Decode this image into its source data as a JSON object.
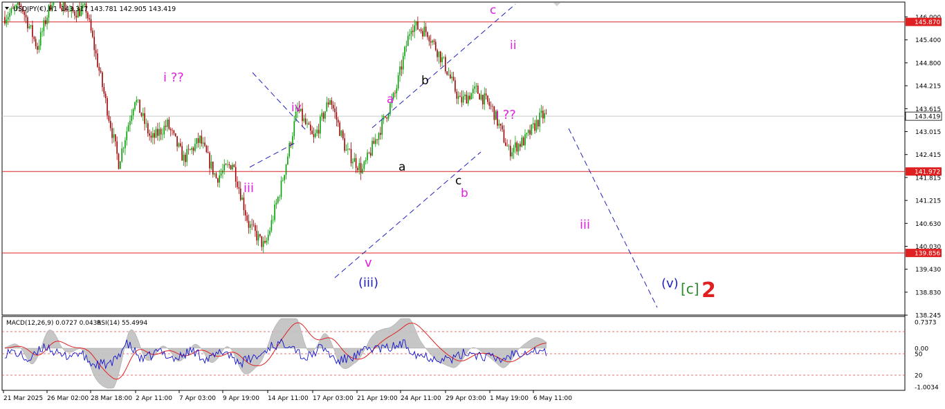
{
  "header": {
    "symbol": "USDJPY(€),H1",
    "ohlc": "143.317 143.781 142.905 143.419"
  },
  "indicator_header": {
    "macd": "MACD(12,26,9) 0.0727 0.0436",
    "rsi": "RSI(14) 55.4994"
  },
  "colors": {
    "candle_up": "#00a000",
    "candle_down": "#a00000",
    "horizontal_level": "#e02020",
    "price_marker": "#e02020",
    "channel": "#2020c0",
    "label_magenta": "#e020e0",
    "label_black": "#000000",
    "label_blue": "#2020c0",
    "label_green": "#2a8a2a",
    "label_red": "#e02020",
    "macd_hist": "#c0c0c0",
    "macd_signal": "#e02020",
    "rsi_line": "#1010d0"
  },
  "chart_data": {
    "type": "candlestick",
    "price_axis_ticks": [
      "146.000",
      "145.400",
      "144.800",
      "144.215",
      "143.615",
      "143.015",
      "142.415",
      "141.815",
      "141.215",
      "140.630",
      "140.030",
      "139.430",
      "138.830",
      "138.245"
    ],
    "ylim": [
      138.245,
      146.2
    ],
    "levels": [
      {
        "value": 145.87,
        "label": "145.870"
      },
      {
        "value": 141.972,
        "label": "141.972"
      },
      {
        "value": 139.856,
        "label": "139.856"
      }
    ],
    "current_price": {
      "value": 143.419,
      "label": "143.419"
    },
    "time_axis_labels": [
      "21 Mar 2025",
      "26 Mar 02:00",
      "28 Mar 18:00",
      "2 Apr 11:00",
      "7 Apr 03:00",
      "9 Apr 19:00",
      "14 Apr 11:00",
      "17 Apr 03:00",
      "21 Apr 19:00",
      "24 Apr 11:00",
      "29 Apr 03:00",
      "1 May 19:00",
      "6 May 11:00"
    ],
    "price_path_bar_index": [
      0,
      10,
      20,
      30,
      40,
      50,
      60,
      70,
      80,
      90,
      100,
      110,
      120,
      130,
      140,
      150,
      160,
      170,
      180,
      190,
      200,
      210,
      220,
      230,
      240,
      250,
      260,
      270,
      280,
      290,
      300,
      310,
      320,
      330,
      340,
      350,
      360,
      370,
      380,
      390
    ],
    "price_path_value": [
      146.0,
      146.3,
      145.2,
      146.6,
      146.1,
      146.2,
      144.2,
      142.2,
      143.9,
      142.8,
      143.2,
      142.3,
      142.8,
      141.8,
      142.2,
      140.6,
      140.0,
      141.6,
      143.6,
      142.8,
      143.9,
      142.5,
      142.0,
      143.0,
      144.0,
      145.8,
      145.6,
      144.8,
      143.8,
      144.1,
      143.6,
      142.5,
      142.8,
      143.419,
      143.419,
      143.419,
      143.419,
      143.419,
      143.419,
      143.419
    ],
    "last_bar_index": 333,
    "wave_labels": [
      {
        "text": "i ??",
        "color": "magenta"
      },
      {
        "text": "iii",
        "color": "magenta"
      },
      {
        "text": "iv",
        "color": "magenta"
      },
      {
        "text": "v",
        "color": "magenta"
      },
      {
        "text": "(iii)",
        "color": "blue"
      },
      {
        "text": "a",
        "color": "magenta"
      },
      {
        "text": "a",
        "color": "black"
      },
      {
        "text": "b",
        "color": "black"
      },
      {
        "text": "c",
        "color": "black"
      },
      {
        "text": "b",
        "color": "magenta"
      },
      {
        "text": "c",
        "color": "magenta"
      },
      {
        "text": "ii",
        "color": "magenta"
      },
      {
        "text": "i ??",
        "color": "magenta"
      },
      {
        "text": "iii",
        "color": "magenta"
      },
      {
        "text": "(v)",
        "color": "blue"
      },
      {
        "text": "[c]",
        "color": "green"
      },
      {
        "text": "2",
        "color": "red"
      }
    ],
    "macd_panel": {
      "axis_ticks": [
        "0.7373",
        "0.00",
        "50",
        "-1.0034",
        "20"
      ],
      "dashed_levels": [
        "80",
        "50",
        "20"
      ]
    }
  }
}
